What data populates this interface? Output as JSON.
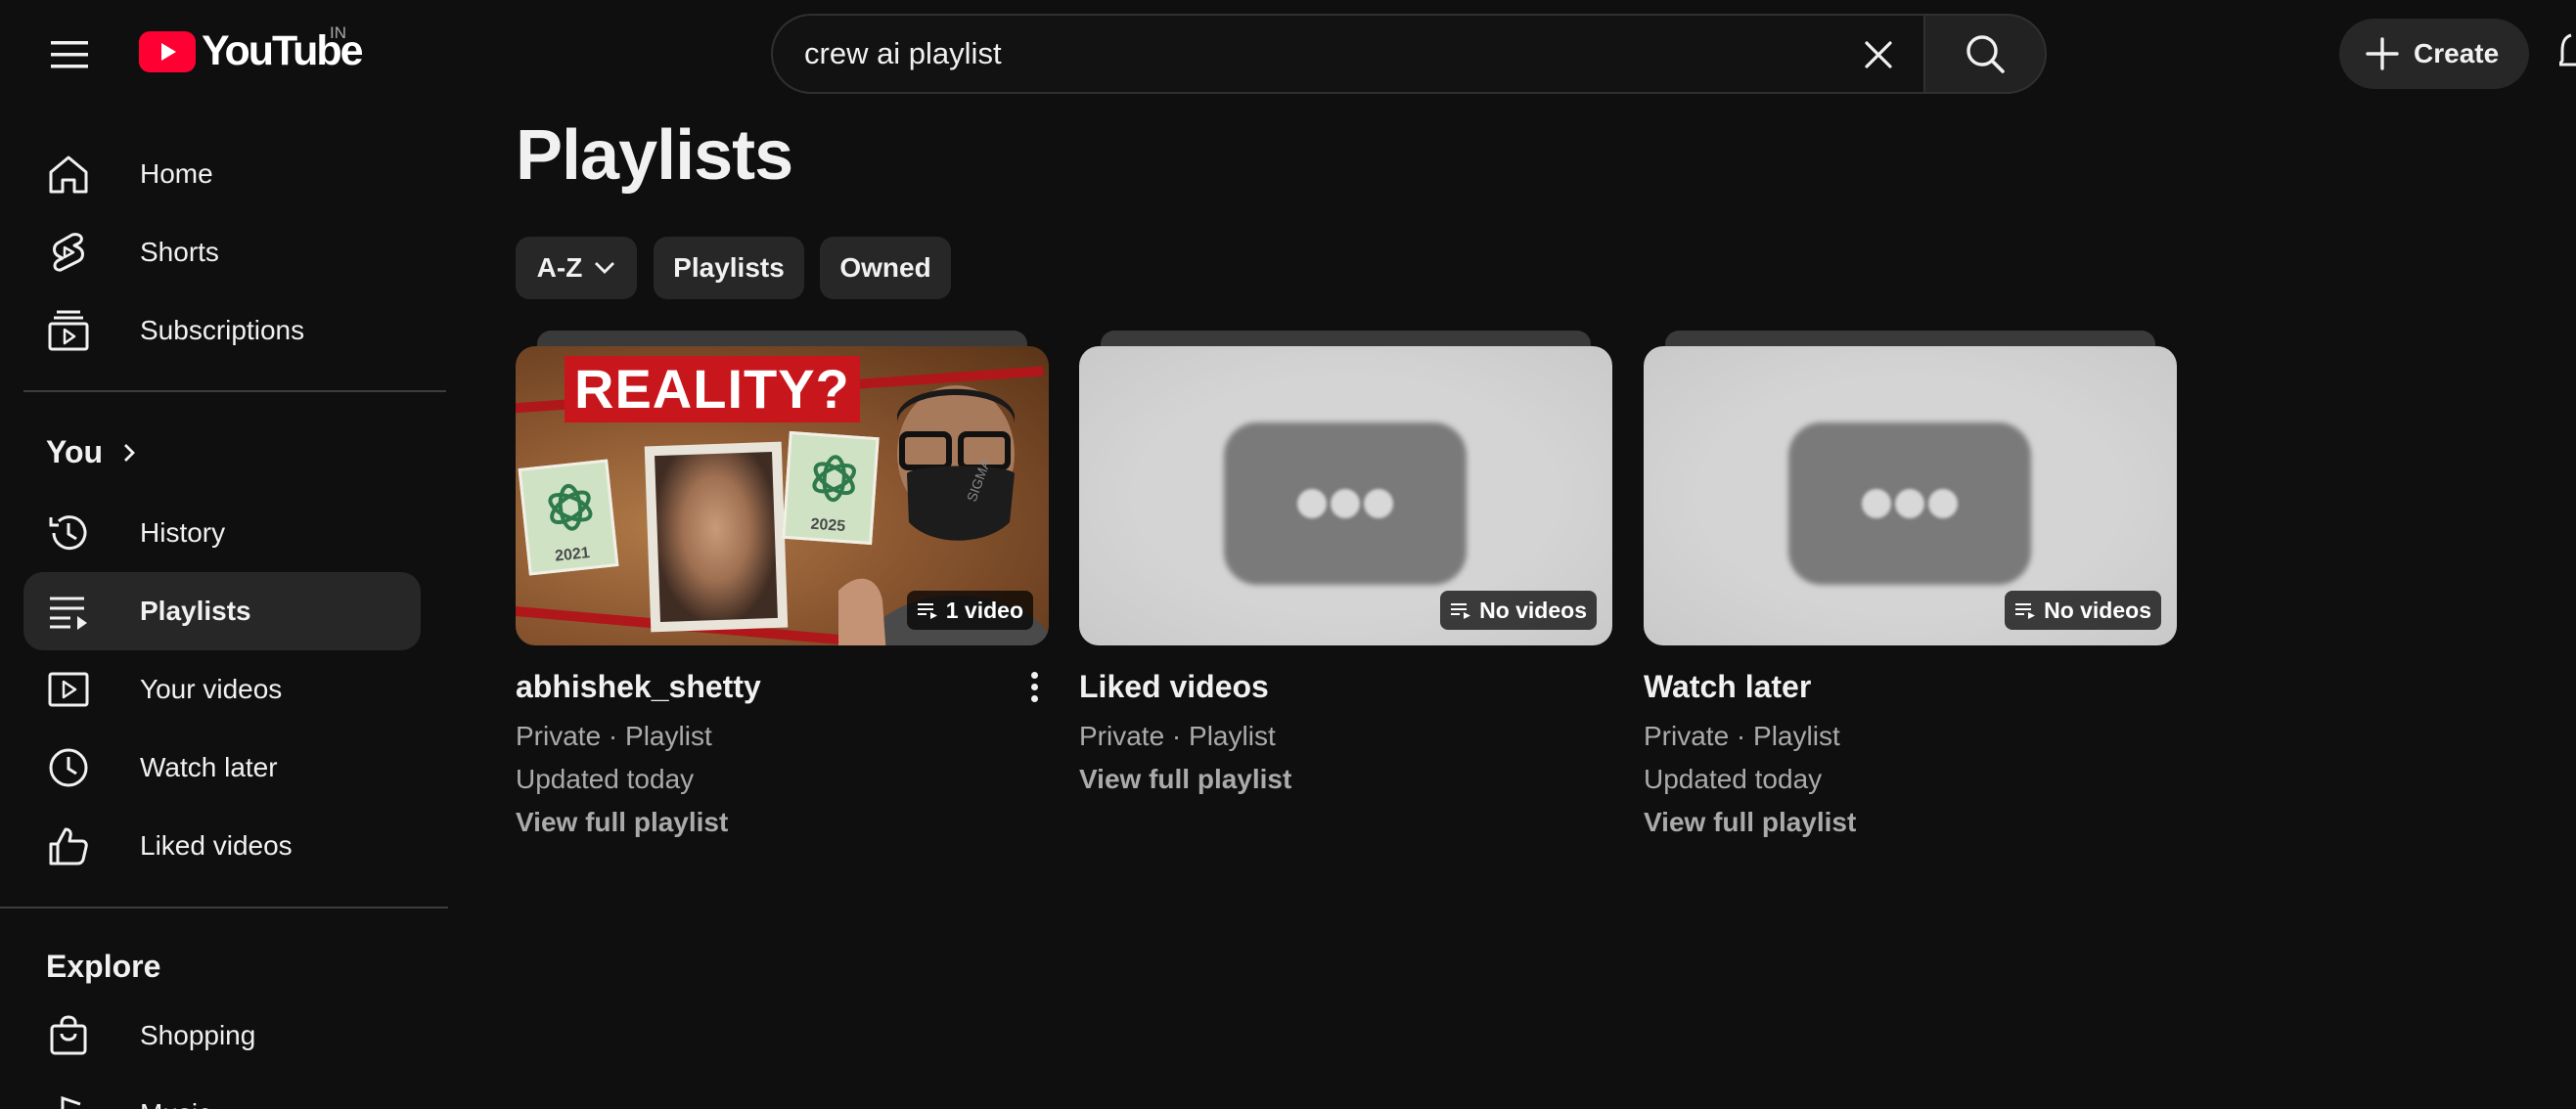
{
  "topbar": {
    "logo_text": "YouTube",
    "country_code": "IN",
    "search_value": "crew ai playlist",
    "create_label": "Create"
  },
  "sidebar": {
    "main_items": [
      {
        "label": "Home",
        "icon": "home-icon"
      },
      {
        "label": "Shorts",
        "icon": "shorts-icon"
      },
      {
        "label": "Subscriptions",
        "icon": "subscriptions-icon"
      }
    ],
    "you_title": "You",
    "you_items": [
      {
        "label": "History",
        "icon": "history-icon"
      },
      {
        "label": "Playlists",
        "icon": "playlists-icon",
        "active": true
      },
      {
        "label": "Your videos",
        "icon": "your-videos-icon"
      },
      {
        "label": "Watch later",
        "icon": "watch-later-icon"
      },
      {
        "label": "Liked videos",
        "icon": "liked-videos-icon"
      }
    ],
    "explore_title": "Explore",
    "explore_items": [
      {
        "label": "Shopping",
        "icon": "shopping-icon"
      },
      {
        "label": "Music",
        "icon": "music-icon"
      }
    ]
  },
  "main": {
    "page_title": "Playlists",
    "chips": [
      {
        "label": "A-Z",
        "has_dropdown": true
      },
      {
        "label": "Playlists"
      },
      {
        "label": "Owned"
      }
    ],
    "playlists": [
      {
        "title": "abhishek_shetty",
        "privacy": "Private · Playlist",
        "updated": "Updated today",
        "link": "View full playlist",
        "count_badge": "1 video",
        "thumbnail_text": "REALITY?",
        "note_left": "2021",
        "note_right": "2025",
        "mask_text": "SIGMA"
      },
      {
        "title": "Liked videos",
        "privacy": "Private · Playlist",
        "link": "View full playlist",
        "count_badge": "No videos"
      },
      {
        "title": "Watch later",
        "privacy": "Private · Playlist",
        "updated": "Updated today",
        "link": "View full playlist",
        "count_badge": "No videos"
      }
    ]
  },
  "colors": {
    "background": "#0f0f0f",
    "surface": "#272727",
    "brand_red": "#ff0033",
    "text_primary": "#f1f1f1",
    "text_secondary": "#aaaaaa"
  }
}
